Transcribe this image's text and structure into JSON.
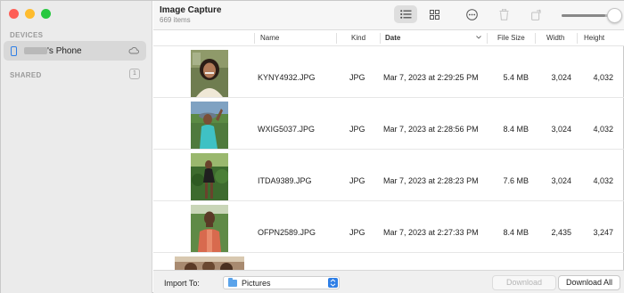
{
  "app": {
    "title": "Image Capture",
    "item_count": "669 items"
  },
  "sidebar": {
    "devices_label": "DEVICES",
    "device_name": "'s Phone",
    "shared_label": "SHARED",
    "shared_count": "1"
  },
  "toolbar": {
    "list_view_icon": "list-icon",
    "grid_view_icon": "grid-icon",
    "more_icon": "ellipsis-circle-icon",
    "delete_icon": "trash-icon",
    "rotate_icon": "rotate-icon",
    "zoom_level": 0.95
  },
  "columns": {
    "name": "Name",
    "kind": "Kind",
    "date": "Date",
    "file_size": "File Size",
    "width": "Width",
    "height": "Height"
  },
  "rows": [
    {
      "name": "KYNY4932.JPG",
      "kind": "JPG",
      "date": "Mar 7, 2023 at 2:29:25 PM",
      "size": "5.4 MB",
      "width": "3,024",
      "height": "4,032"
    },
    {
      "name": "WXIG5037.JPG",
      "kind": "JPG",
      "date": "Mar 7, 2023 at 2:28:56 PM",
      "size": "8.4 MB",
      "width": "3,024",
      "height": "4,032"
    },
    {
      "name": "ITDA9389.JPG",
      "kind": "JPG",
      "date": "Mar 7, 2023 at 2:28:23 PM",
      "size": "7.6 MB",
      "width": "3,024",
      "height": "4,032"
    },
    {
      "name": "OFPN2589.JPG",
      "kind": "JPG",
      "date": "Mar 7, 2023 at 2:27:33 PM",
      "size": "8.4 MB",
      "width": "2,435",
      "height": "3,247"
    }
  ],
  "bottom": {
    "import_label": "Import To:",
    "import_value": "Pictures",
    "download_label": "Download",
    "download_all_label": "Download All"
  },
  "colors": {
    "accent": "#2f7fe6",
    "sidebar_bg": "#ebebeb"
  }
}
